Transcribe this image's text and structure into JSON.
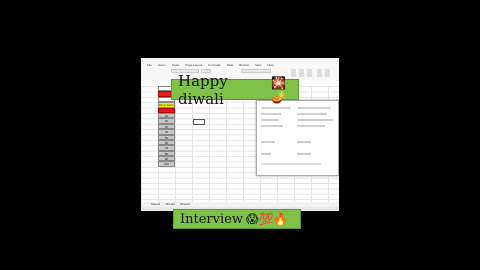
{
  "spreadsheet": {
    "menu": [
      "File",
      "Home",
      "Insert",
      "Page Layout",
      "Formulas",
      "Data",
      "Review",
      "View",
      "Help"
    ],
    "column_b_cells": [
      {
        "text": "",
        "style": "plain"
      },
      {
        "text": "",
        "style": "red"
      },
      {
        "text": "",
        "style": "plain"
      },
      {
        "text": "Drop down",
        "style": "yellow"
      },
      {
        "text": "",
        "style": "red"
      },
      {
        "text": "10",
        "style": "gray"
      },
      {
        "text": "20",
        "style": "gray"
      },
      {
        "text": "30",
        "style": "gray"
      },
      {
        "text": "40",
        "style": "gray"
      },
      {
        "text": "50",
        "style": "gray"
      },
      {
        "text": "60",
        "style": "gray"
      },
      {
        "text": "70",
        "style": "gray"
      },
      {
        "text": "80",
        "style": "gray"
      },
      {
        "text": "90",
        "style": "gray"
      },
      {
        "text": "100",
        "style": "gray"
      }
    ],
    "sheet_tabs": [
      "Sheet1",
      "Sheet2",
      "Sheet3"
    ]
  },
  "overlay": {
    "top_caption": "Happy diwali",
    "top_emoji": "🎇🪔",
    "bottom_caption": "Interview",
    "bottom_emoji": "😱💯🔥"
  },
  "colors": {
    "banner": "#7ec24a",
    "red_cell": "#e21c1c",
    "yellow_cell": "#f6f000"
  }
}
